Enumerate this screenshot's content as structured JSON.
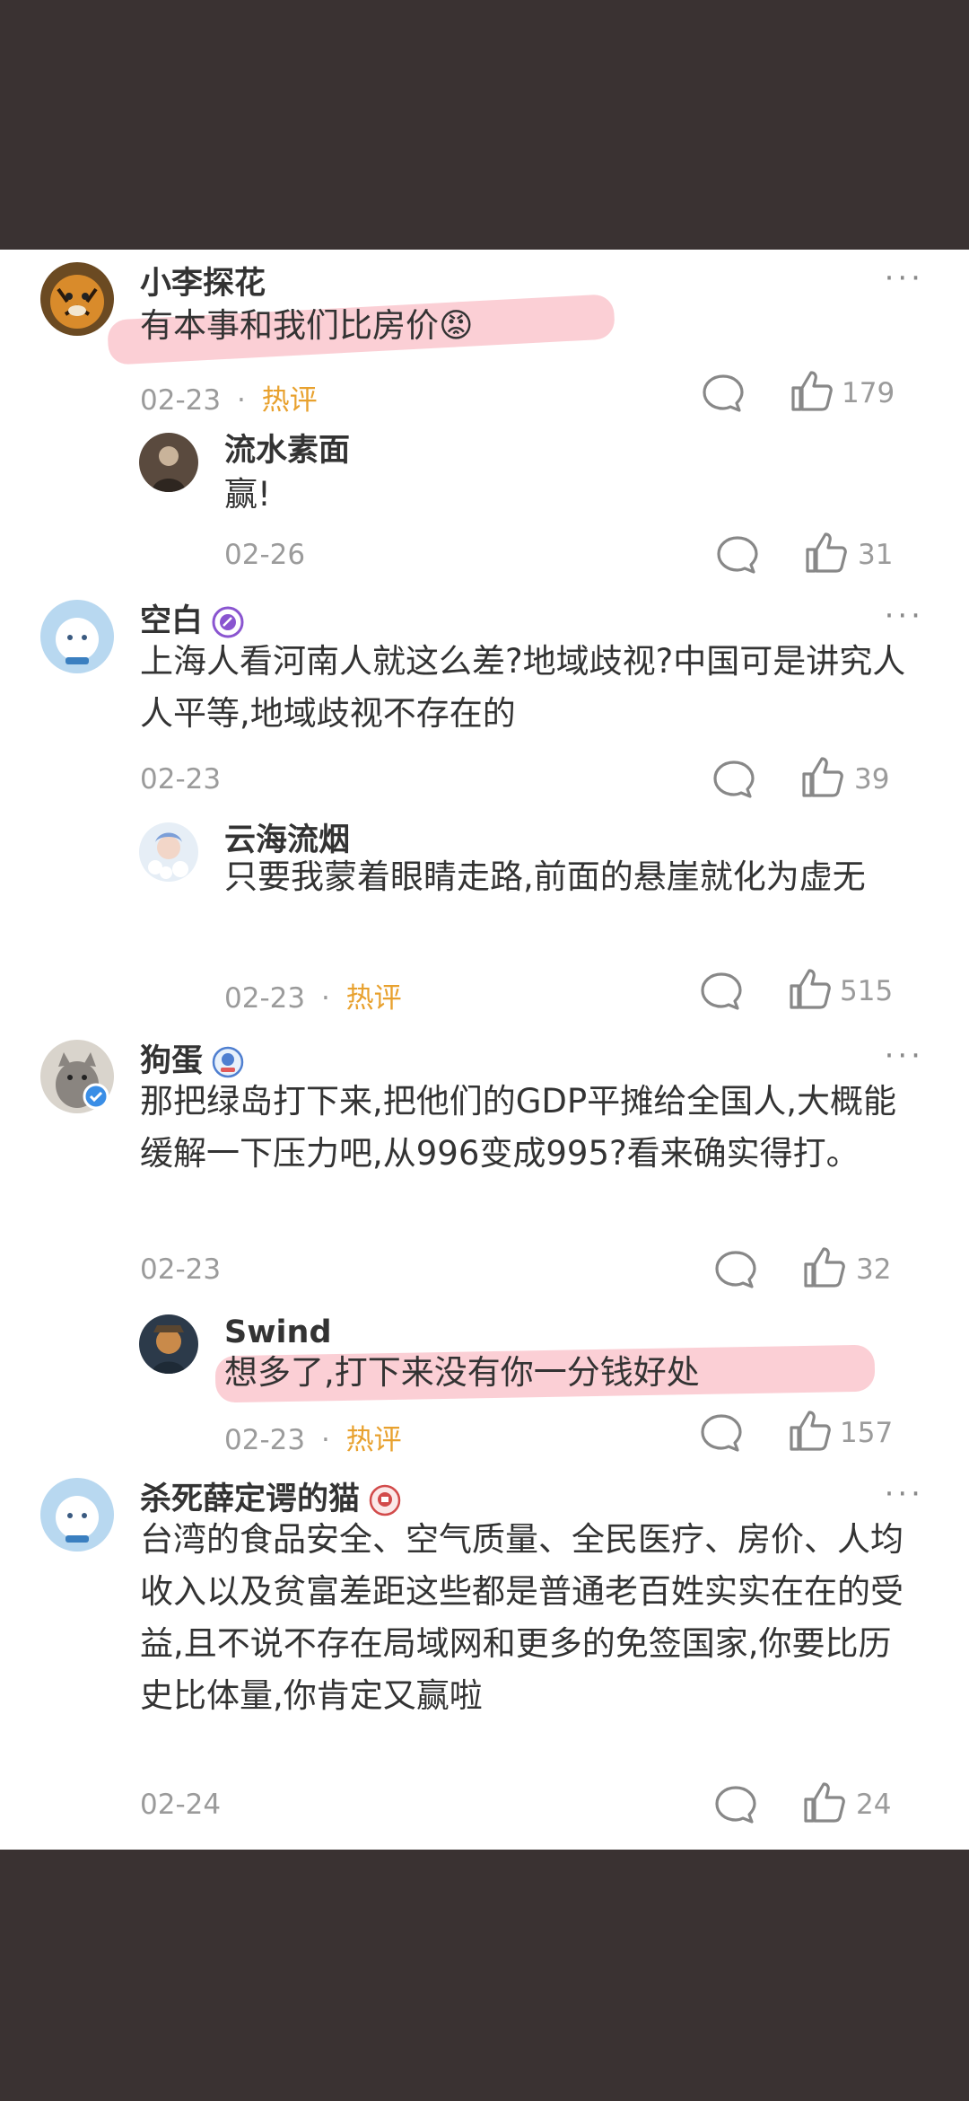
{
  "comments": [
    {
      "user": "小李探花",
      "text": "有本事和我们比房价😡",
      "date": "02-23",
      "tag": "热评",
      "likes": "179",
      "reply": {
        "user": "流水素面",
        "text": "赢!",
        "date": "02-26",
        "likes": "31"
      }
    },
    {
      "user": "空白",
      "text": "上海人看河南人就这么差?地域歧视?中国可是讲究人人平等,地域歧视不存在的",
      "date": "02-23",
      "likes": "39",
      "reply": {
        "user": "云海流烟",
        "text": "只要我蒙着眼睛走路,前面的悬崖就化为虚无",
        "date": "02-23",
        "tag": "热评",
        "likes": "515"
      }
    },
    {
      "user": "狗蛋",
      "text": "那把绿岛打下来,把他们的GDP平摊给全国人,大概能缓解一下压力吧,从996变成995?看来确实得打。",
      "date": "02-23",
      "likes": "32",
      "reply": {
        "user": "Swind",
        "text": "想多了,打下来没有你一分钱好处",
        "date": "02-23",
        "tag": "热评",
        "likes": "157"
      }
    },
    {
      "user": "杀死薛定谔的猫",
      "text": "台湾的食品安全、空气质量、全民医疗、房价、人均收入以及贫富差距这些都是普通老百姓实实在在的受益,且不说不存在局域网和更多的免签国家,你要比历史比体量,你肯定又赢啦",
      "date": "02-24",
      "likes": "24"
    }
  ],
  "colors": {
    "hot_tag": "#e8a12e",
    "highlight": "#f8a8b2",
    "backdrop": "#3a3232"
  },
  "icons": {
    "more": "more-dots-icon",
    "comment": "comment-bubble-icon",
    "like": "thumbs-up-icon"
  },
  "dots": "···",
  "separator": "·"
}
